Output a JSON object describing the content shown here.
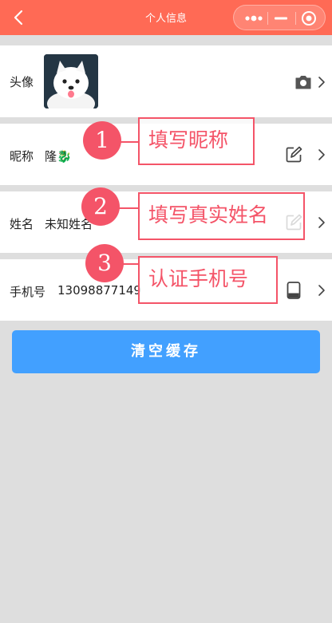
{
  "header": {
    "title": "个人信息",
    "bg_color": "#ff6a55",
    "back_icon": "chevron-left-icon",
    "capsule_icons": [
      "more-dots-icon",
      "minimize-icon",
      "close-target-icon"
    ]
  },
  "rows": {
    "avatar": {
      "label": "头像",
      "action_icon": "camera-icon"
    },
    "nickname": {
      "label": "昵称",
      "value": "隆🐉",
      "action_icon": "edit-icon"
    },
    "name": {
      "label": "姓名",
      "value": "未知姓名",
      "action_icon": "edit-icon"
    },
    "phone": {
      "label": "手机号",
      "value": "13098877149",
      "action_icon": "phone-icon"
    }
  },
  "clear_cache_label": "清空缓存",
  "clear_cache_color": "#42a0ff",
  "annotations": [
    {
      "number": "1",
      "text": "填写昵称"
    },
    {
      "number": "2",
      "text": "填写真实姓名"
    },
    {
      "number": "3",
      "text": "认证手机号"
    }
  ],
  "annotation_color": "#f45468"
}
